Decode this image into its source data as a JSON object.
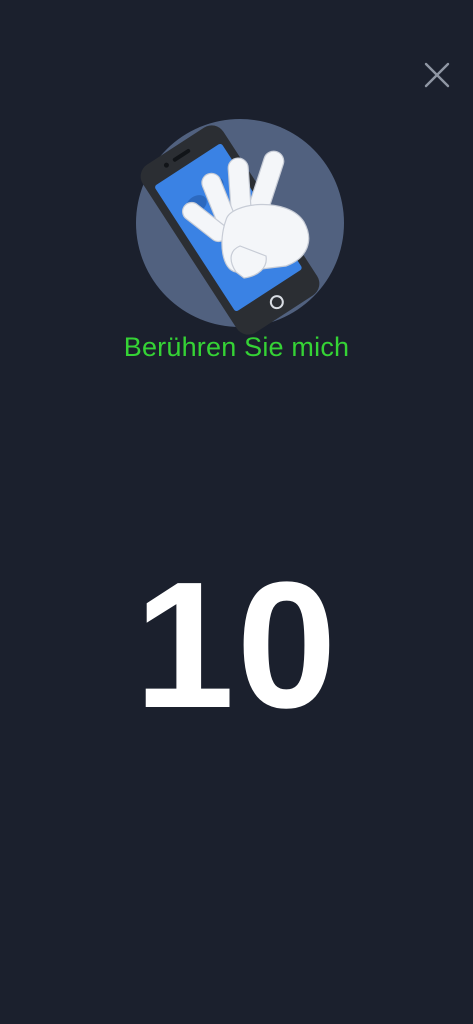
{
  "screen": {
    "instruction_text": "Berühren Sie mich",
    "countdown_value": "10"
  },
  "icons": {
    "close": "close-icon",
    "illustration": "phone-touch-hand-icon"
  },
  "colors": {
    "background": "#1b202d",
    "instruction": "#35d335",
    "countdown": "#ffffff",
    "circle": "#51617f",
    "phone_screen": "#3a82e4"
  }
}
